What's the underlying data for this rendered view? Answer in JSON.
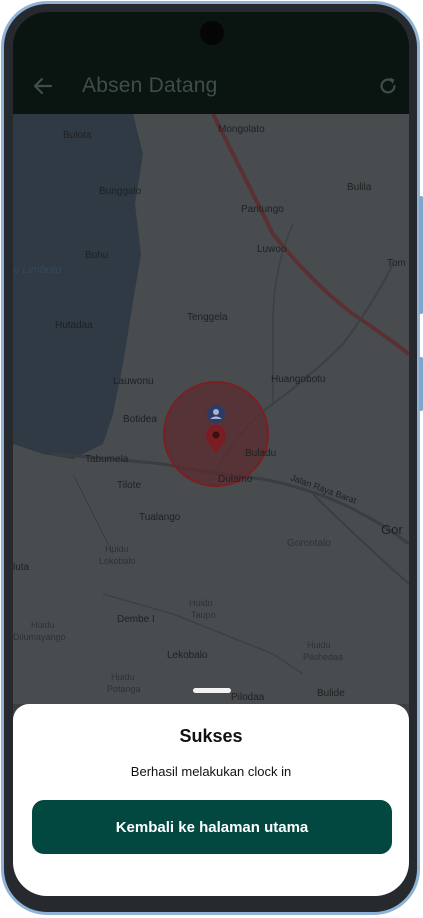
{
  "app_bar": {
    "title": "Absen Datang",
    "back_icon": "arrow-left-icon",
    "refresh_icon": "refresh-icon"
  },
  "map": {
    "labels": {
      "bulota": "Bulota",
      "mongolato": "Mongolato",
      "bunggalo": "Bunggalo",
      "bulila": "Bulila",
      "pantungo": "Pantungo",
      "buhu": "Buhu",
      "luwoo": "Luwoo",
      "tomulabutao": "Tom",
      "danau_limboto": "o Limboto",
      "hutadaa": "Hutadaa",
      "tenggela": "Tenggela",
      "lauwonu": "Lauwonu",
      "huangobotu": "Huangobotu",
      "botidea": "Botidea",
      "tabumela": "Tabumela",
      "buladu": "Buladu",
      "dulamo": "Dulamo",
      "tilote": "Tilote",
      "jalan_raya": "Jalan Raya Barat",
      "tualango": "Tualango",
      "gorontalo_big": "Gor",
      "huidu_lokobalo_1": "Huidu",
      "huidu_lokobalo_2": "Lokobalo",
      "gorontalo": "Gorontalo",
      "luta": "luta",
      "huidu_taupo_1": "Huidu",
      "huidu_taupo_2": "Taupo",
      "dembe": "Dembe I",
      "huidu_dilumayango_1": "Huidu",
      "huidu_dilumayango_2": "Dilumayango",
      "huidu_pilohedaa_1": "Huidu",
      "huidu_pilohedaa_2": "Pilohedaa",
      "lekobalo": "Lekobalo",
      "huidu_pelangga_1": "Huidu",
      "huidu_pelangga_2": "Potanga",
      "pilohedaa": "Pilodaa",
      "bulide": "Bulide"
    },
    "marker_icon": "location-pin-icon",
    "user_icon": "user-location-icon"
  },
  "sheet": {
    "title": "Sukses",
    "message": "Berhasil melakukan clock in",
    "button_label": "Kembali ke halaman utama"
  },
  "colors": {
    "appbar": "#0a1411",
    "button": "#034741",
    "radius_circle": "#7a1f24"
  }
}
